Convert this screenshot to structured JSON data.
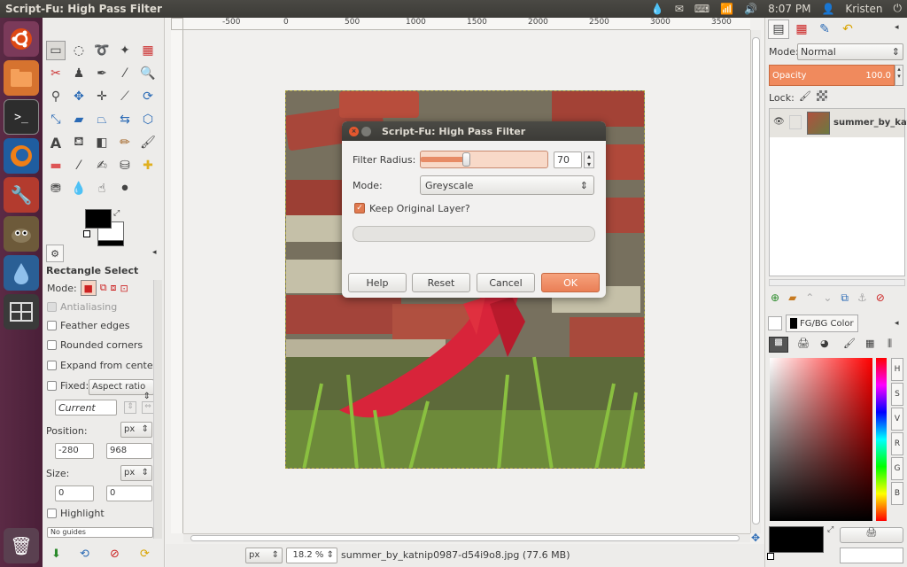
{
  "topbar": {
    "title": "Script-Fu: High Pass Filter",
    "clock": "8:07 PM",
    "user": "Kristen"
  },
  "launcher": {
    "items": [
      "dash-home",
      "files",
      "terminal",
      "firefox",
      "settings",
      "gimp",
      "droplet",
      "workspaces",
      "trash"
    ]
  },
  "toolbox": {
    "tool_options_title": "Rectangle Select",
    "mode_label": "Mode:",
    "antialiasing": "Antialiasing",
    "feather_edges": "Feather edges",
    "rounded_corners": "Rounded corners",
    "expand_from_center": "Expand from center",
    "fixed_label": "Fixed:",
    "fixed_value": "Aspect ratio",
    "current_value": "Current",
    "position_label": "Position:",
    "position_unit": "px",
    "position_x": "-280",
    "position_y": "968",
    "size_label": "Size:",
    "size_unit": "px",
    "size_w": "0",
    "size_h": "0",
    "highlight": "Highlight",
    "guides": "No guides"
  },
  "canvas": {
    "ruler_labels": [
      "-500",
      "0",
      "500",
      "1000",
      "1500",
      "2000",
      "2500",
      "3000",
      "3500"
    ],
    "status_unit": "px",
    "zoom": "18.2 %",
    "status_text": "summer_by_katnip0987-d54i9o8.jpg (77.6 MB)"
  },
  "dialog": {
    "title": "Script-Fu: High Pass Filter",
    "filter_radius_label": "Filter Radius:",
    "filter_radius_value": "70",
    "filter_radius_fraction": 0.21,
    "mode_label": "Mode:",
    "mode_value": "Greyscale",
    "keep_original_label": "Keep Original Layer?",
    "keep_original_checked": true,
    "buttons": {
      "help": "Help",
      "reset": "Reset",
      "cancel": "Cancel",
      "ok": "OK"
    }
  },
  "layers": {
    "mode_label": "Mode:",
    "mode_value": "Normal",
    "opacity_label": "Opacity",
    "opacity_value": "100.0",
    "lock_label": "Lock:",
    "layer_name": "summer_by_katn"
  },
  "colors_panel": {
    "tab_label": "FG/BG Color",
    "channels": [
      "H",
      "S",
      "V",
      "R",
      "G",
      "B"
    ]
  },
  "colors": {
    "accent": "#f08a5d",
    "titlebar": "#3c3b37",
    "launcher": "#4a1f38"
  }
}
